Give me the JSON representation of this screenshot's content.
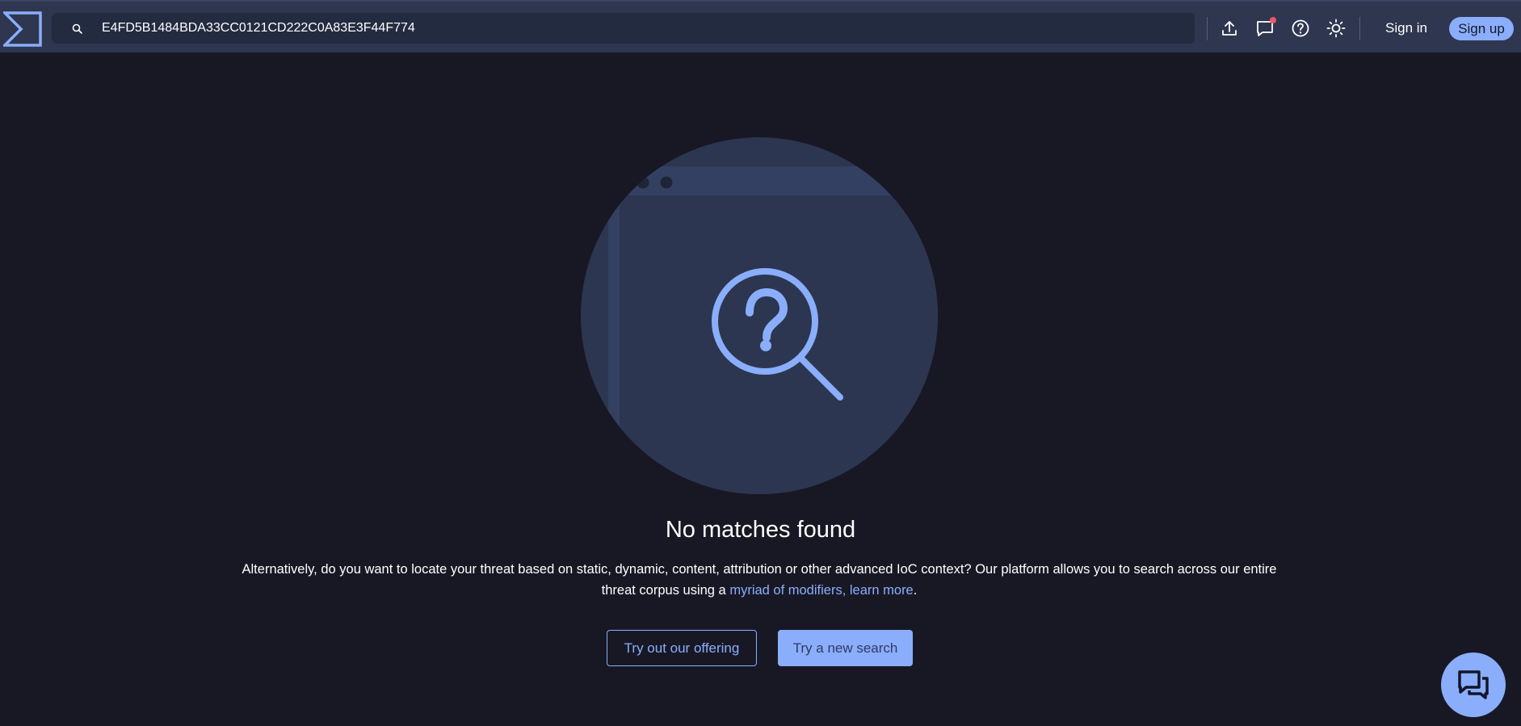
{
  "header": {
    "logo": "virustotal-logo",
    "search": {
      "value": "E4FD5B1484BDA33CC0121CD222C0A83E3F44F774",
      "placeholder": ""
    },
    "icons": [
      "upload-icon",
      "chat-bubble-icon",
      "help-icon",
      "theme-toggle-icon"
    ],
    "sign_in_label": "Sign in",
    "sign_up_label": "Sign up"
  },
  "main": {
    "headline": "No matches found",
    "description_before_link": "Alternatively, do you want to locate your threat based on static, dynamic, content, attribution or other advanced IoC context? Our platform allows you to search across our entire threat corpus using a ",
    "description_link": "myriad of modifiers, learn more",
    "description_after_link": ".",
    "btn_offering": "Try out our offering",
    "btn_new_search": "Try a new search"
  },
  "colors": {
    "background": "#181825",
    "topbar": "#2e3650",
    "accent": "#8aaefb",
    "notification": "#f0556b"
  }
}
